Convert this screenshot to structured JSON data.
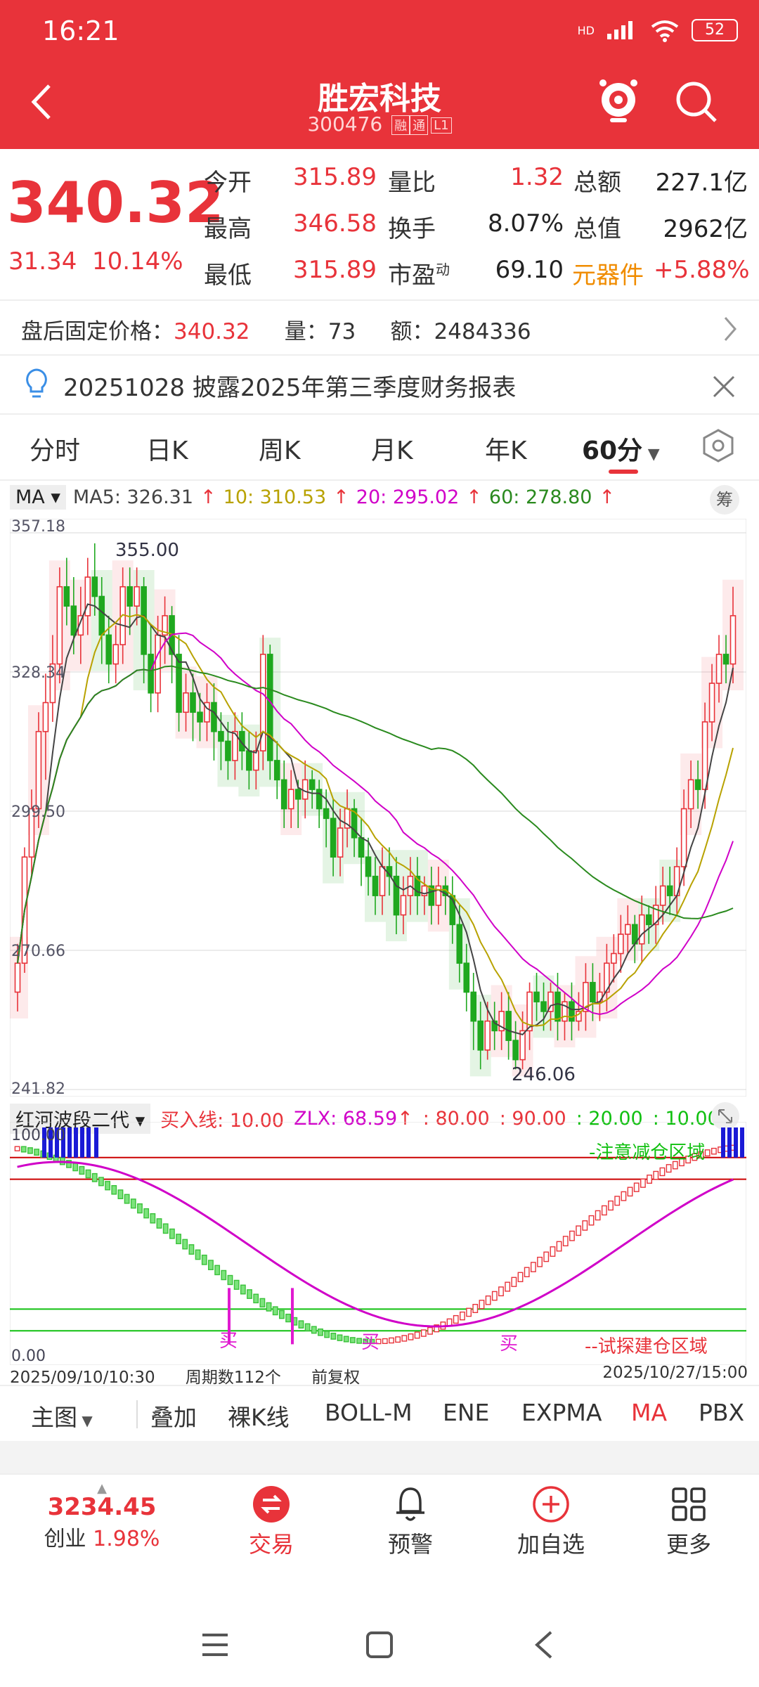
{
  "status": {
    "time": "16:21",
    "battery": "52",
    "network": "HD"
  },
  "header": {
    "title": "胜宏科技",
    "code": "300476",
    "tag1": "融",
    "tag2": "通",
    "tag3": "L1"
  },
  "quote": {
    "price": "340.32",
    "change": "31.34",
    "change_pct": "10.14%",
    "rows": [
      {
        "k1": "今开",
        "v1": "315.89",
        "k2": "量比",
        "v2": "1.32",
        "k3": "总额",
        "v3": "227.1亿"
      },
      {
        "k1": "最高",
        "v1": "346.58",
        "k2": "换手",
        "v2": "8.07%",
        "k3": "总值",
        "v3": "2962亿"
      },
      {
        "k1": "最低",
        "v1": "315.89",
        "k2": "市盈",
        "k2_sup": "动",
        "v2": "69.10",
        "k3": "元器件",
        "v3": "+5.88%"
      }
    ]
  },
  "afterhours": {
    "label": "盘后固定价格：",
    "price": "340.32",
    "vol_label": "量：",
    "vol": "73",
    "amt_label": "额：",
    "amt": "2484336"
  },
  "news": {
    "text": "20251028 披露2025年第三季度财务报表"
  },
  "period_tabs": [
    "分时",
    "日K",
    "周K",
    "月K",
    "年K",
    "60分"
  ],
  "ma": {
    "label": "MA",
    "ma5": "MA5: 326.31",
    "ma10": "10: 310.53",
    "ma20": "20: 295.02",
    "ma60": "60: 278.80",
    "chip_label": "筹"
  },
  "kchart_labels": {
    "y_top": "357.18",
    "y_2": "328.34",
    "y_3": "299.50",
    "y_4": "270.66",
    "y_bottom": "241.82",
    "hi": "355.00",
    "lo": "246.06"
  },
  "indicator": {
    "name": "红河波段二代",
    "buy_line": "买入线: 10.00",
    "zlx": "ZLX: 68.59",
    "v80": ": 80.00",
    "v90": ": 90.00",
    "v20": ": 20.00",
    "v10": ": 10.00",
    "y_top": "100.00",
    "y_bottom": "0.00",
    "zone_top": "-注意减仓区域",
    "zone_bottom": "--试探建仓区域",
    "buy_mark": "买"
  },
  "dates": {
    "start": "2025/09/10/10:30",
    "count": "周期数112个",
    "adj": "前复权",
    "end": "2025/10/27/15:00"
  },
  "indicator_tabs": [
    "主图",
    "叠加",
    "裸K线",
    "BOLL-M",
    "ENE",
    "EXPMA",
    "MA",
    "PBX"
  ],
  "bottom_nav": {
    "index_value": "3234.45",
    "index_name": "创业",
    "index_pct": "1.98%",
    "trade": "交易",
    "alert": "预警",
    "add": "加自选",
    "more": "更多"
  },
  "chart_data": {
    "type": "candlestick",
    "ylim": [
      241.82,
      357.18
    ],
    "high_mark": 355.0,
    "low_mark": 246.06,
    "candles": [
      [
        262,
        268,
        258,
        272
      ],
      [
        268,
        290,
        266,
        292
      ],
      [
        290,
        300,
        286,
        304
      ],
      [
        300,
        316,
        296,
        320
      ],
      [
        316,
        322,
        306,
        328
      ],
      [
        322,
        330,
        318,
        336
      ],
      [
        330,
        346,
        326,
        350
      ],
      [
        346,
        342,
        338,
        352
      ],
      [
        342,
        336,
        332,
        348
      ],
      [
        336,
        340,
        330,
        346
      ],
      [
        340,
        348,
        336,
        352
      ],
      [
        348,
        344,
        340,
        355
      ],
      [
        344,
        336,
        330,
        348
      ],
      [
        336,
        330,
        326,
        340
      ],
      [
        330,
        334,
        326,
        338
      ],
      [
        334,
        346,
        330,
        350
      ],
      [
        346,
        342,
        336,
        350
      ],
      [
        342,
        346,
        338,
        350
      ],
      [
        346,
        332,
        326,
        348
      ],
      [
        332,
        324,
        320,
        338
      ],
      [
        324,
        336,
        320,
        340
      ],
      [
        336,
        340,
        330,
        344
      ],
      [
        340,
        332,
        326,
        342
      ],
      [
        332,
        320,
        316,
        336
      ],
      [
        320,
        324,
        316,
        328
      ],
      [
        324,
        320,
        314,
        328
      ],
      [
        320,
        318,
        314,
        324
      ],
      [
        318,
        322,
        314,
        326
      ],
      [
        322,
        316,
        310,
        326
      ],
      [
        316,
        314,
        308,
        320
      ],
      [
        314,
        310,
        306,
        318
      ],
      [
        310,
        316,
        306,
        320
      ],
      [
        316,
        312,
        308,
        320
      ],
      [
        312,
        308,
        304,
        316
      ],
      [
        308,
        312,
        304,
        316
      ],
      [
        312,
        332,
        308,
        336
      ],
      [
        332,
        310,
        306,
        334
      ],
      [
        310,
        306,
        302,
        314
      ],
      [
        306,
        300,
        296,
        310
      ],
      [
        300,
        304,
        296,
        308
      ],
      [
        304,
        302,
        296,
        306
      ],
      [
        302,
        306,
        298,
        310
      ],
      [
        306,
        304,
        300,
        308
      ],
      [
        304,
        300,
        296,
        306
      ],
      [
        300,
        298,
        292,
        304
      ],
      [
        298,
        290,
        286,
        302
      ],
      [
        290,
        296,
        286,
        300
      ],
      [
        296,
        300,
        292,
        304
      ],
      [
        300,
        294,
        290,
        302
      ],
      [
        294,
        290,
        284,
        298
      ],
      [
        290,
        286,
        282,
        294
      ],
      [
        286,
        282,
        278,
        290
      ],
      [
        282,
        288,
        278,
        292
      ],
      [
        288,
        286,
        282,
        292
      ],
      [
        286,
        278,
        274,
        290
      ],
      [
        278,
        282,
        274,
        286
      ],
      [
        282,
        286,
        278,
        290
      ],
      [
        286,
        282,
        278,
        290
      ],
      [
        282,
        284,
        278,
        286
      ],
      [
        284,
        280,
        276,
        288
      ],
      [
        280,
        284,
        276,
        288
      ],
      [
        284,
        282,
        278,
        286
      ],
      [
        282,
        276,
        272,
        286
      ],
      [
        276,
        268,
        264,
        280
      ],
      [
        268,
        262,
        258,
        272
      ],
      [
        262,
        256,
        250,
        266
      ],
      [
        256,
        250,
        246,
        260
      ],
      [
        250,
        256,
        248,
        260
      ],
      [
        256,
        254,
        250,
        260
      ],
      [
        254,
        258,
        250,
        262
      ],
      [
        258,
        252,
        248,
        262
      ],
      [
        252,
        248,
        246,
        256
      ],
      [
        248,
        254,
        246,
        258
      ],
      [
        254,
        262,
        250,
        264
      ],
      [
        262,
        260,
        256,
        266
      ],
      [
        260,
        258,
        254,
        264
      ],
      [
        258,
        262,
        254,
        264
      ],
      [
        262,
        256,
        252,
        266
      ],
      [
        256,
        260,
        252,
        262
      ],
      [
        260,
        256,
        252,
        264
      ],
      [
        256,
        258,
        254,
        262
      ],
      [
        258,
        264,
        254,
        268
      ],
      [
        264,
        260,
        256,
        268
      ],
      [
        260,
        262,
        256,
        266
      ],
      [
        262,
        268,
        258,
        272
      ],
      [
        268,
        270,
        264,
        274
      ],
      [
        270,
        274,
        266,
        278
      ],
      [
        274,
        276,
        270,
        280
      ],
      [
        276,
        272,
        268,
        278
      ],
      [
        272,
        278,
        268,
        282
      ],
      [
        278,
        276,
        272,
        280
      ],
      [
        276,
        280,
        272,
        284
      ],
      [
        280,
        284,
        276,
        288
      ],
      [
        284,
        282,
        278,
        288
      ],
      [
        282,
        288,
        278,
        292
      ],
      [
        288,
        300,
        284,
        304
      ],
      [
        300,
        306,
        296,
        310
      ],
      [
        306,
        304,
        300,
        310
      ],
      [
        304,
        318,
        300,
        322
      ],
      [
        318,
        326,
        314,
        330
      ],
      [
        326,
        332,
        322,
        336
      ],
      [
        332,
        330,
        326,
        336
      ],
      [
        330,
        340,
        326,
        346
      ]
    ],
    "indicator_series": {
      "zlx_last": 68.59,
      "levels": [
        80,
        90,
        20,
        10
      ]
    }
  }
}
